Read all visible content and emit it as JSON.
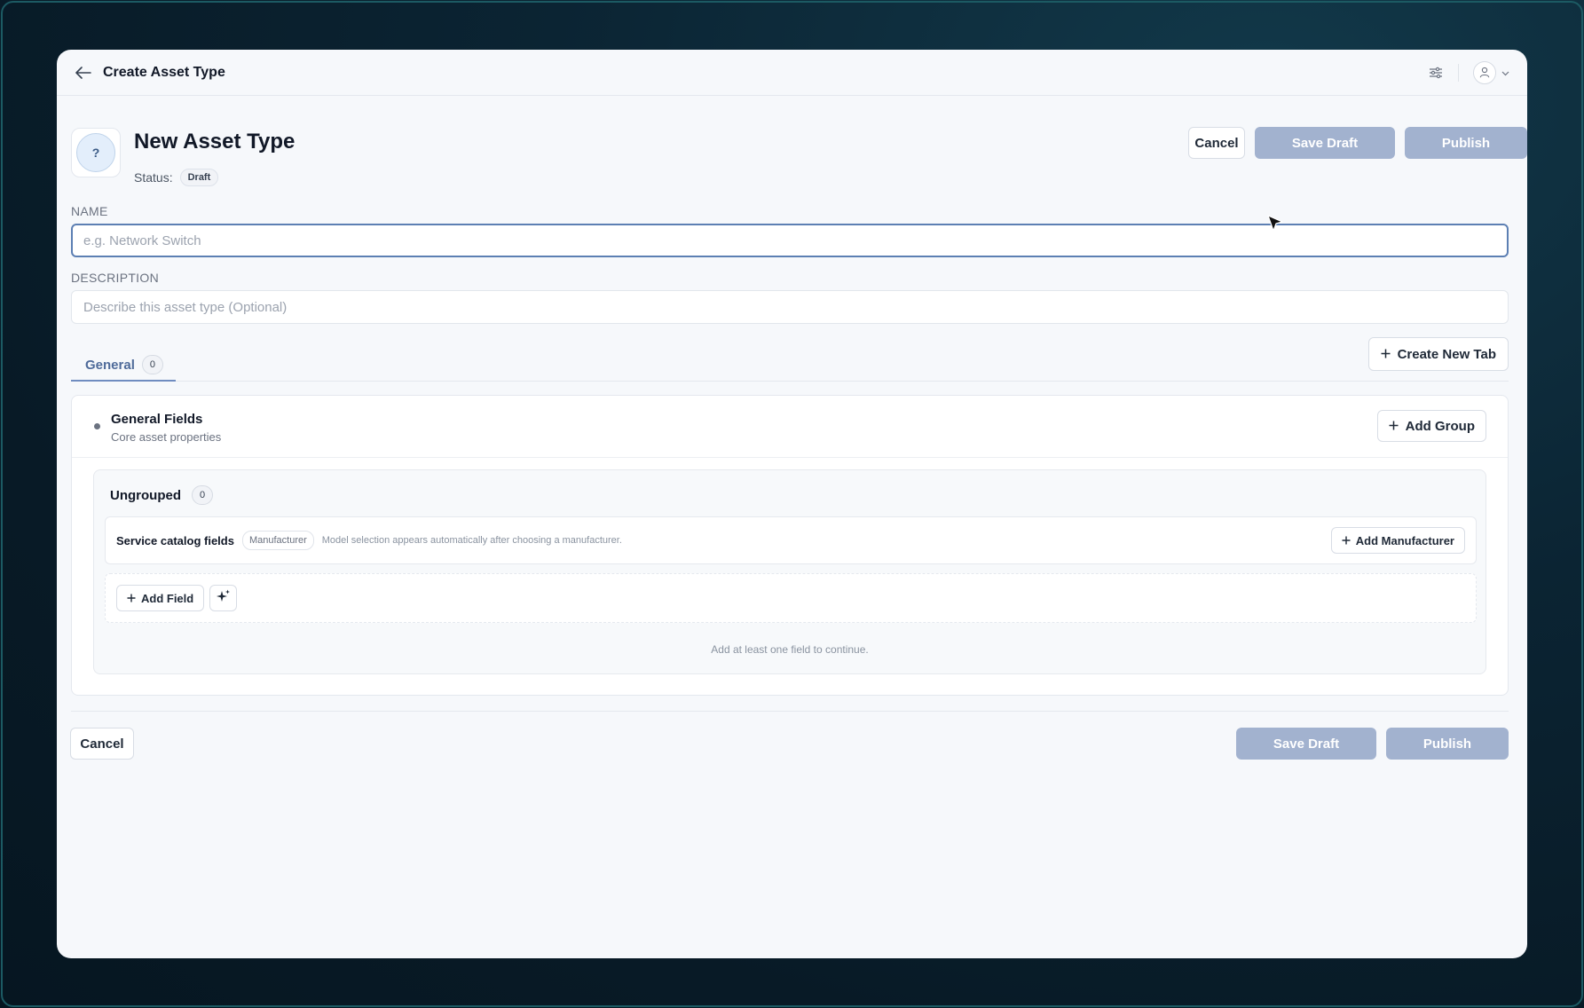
{
  "topbar": {
    "title": "Create Asset Type",
    "back_icon": "arrow-left-icon",
    "settings_icon": "sliders-icon",
    "user_icon": "user-icon"
  },
  "header": {
    "icon_text": "?",
    "title": "New Asset Type",
    "status_label": "Status:",
    "status_value": "Draft",
    "cancel_label": "Cancel",
    "save_draft_label": "Save Draft",
    "publish_label": "Publish"
  },
  "form": {
    "name_label": "NAME",
    "name_placeholder": "e.g. Network Switch",
    "name_value": "",
    "description_label": "DESCRIPTION",
    "description_placeholder": "Describe this asset type (Optional)",
    "description_value": ""
  },
  "tabs": {
    "items": [
      {
        "label": "General",
        "count": "0"
      }
    ],
    "create_new_tab_label": "Create New Tab"
  },
  "section": {
    "title": "General Fields",
    "subtitle": "Core asset properties",
    "add_group_label": "Add Group",
    "group": {
      "title": "Ungrouped",
      "count": "0",
      "catalog_title": "Service catalog fields",
      "catalog_chip": "Manufacturer",
      "catalog_hint": "Model selection appears automatically after choosing a manufacturer.",
      "add_manufacturer_label": "Add Manufacturer",
      "add_field_label": "Add Field",
      "continue_hint": "Add at least one field to continue."
    }
  },
  "footer": {
    "cancel_label": "Cancel",
    "save_draft_label": "Save Draft",
    "publish_label": "Publish"
  },
  "colors": {
    "primary_disabled": "#a2b2cf",
    "focus_border": "#5c7fb3",
    "tab_active": "#4f6b9a"
  }
}
